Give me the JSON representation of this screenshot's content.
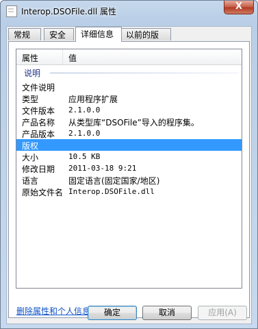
{
  "window": {
    "title": "Interop.DSOFile.dll 属性",
    "close_glyph": "X"
  },
  "tabs": [
    {
      "label": "常规"
    },
    {
      "label": "安全"
    },
    {
      "label": "详细信息"
    },
    {
      "label": "以前的版本"
    }
  ],
  "details": {
    "column_property": "属性",
    "column_value": "值",
    "group_label": "说明",
    "rows": [
      {
        "name": "文件说明",
        "value": ""
      },
      {
        "name": "类型",
        "value": "应用程序扩展"
      },
      {
        "name": "文件版本",
        "value": "2.1.0.0"
      },
      {
        "name": "产品名称",
        "value": "从类型库“DSOFile”导入的程序集。"
      },
      {
        "name": "产品版本",
        "value": "2.1.0.0"
      },
      {
        "name": "版权",
        "value": ""
      },
      {
        "name": "大小",
        "value": "10.5 KB"
      },
      {
        "name": "修改日期",
        "value": "2011-03-18 9:21"
      },
      {
        "name": "语言",
        "value": "固定语言(固定国家/地区)"
      },
      {
        "name": "原始文件名",
        "value": "Interop.DSOFile.dll"
      }
    ],
    "selected_row": "版权"
  },
  "remove_link": "删除属性和个人信息",
  "buttons": {
    "ok": "确定",
    "cancel": "取消",
    "apply": "应用(A)"
  }
}
